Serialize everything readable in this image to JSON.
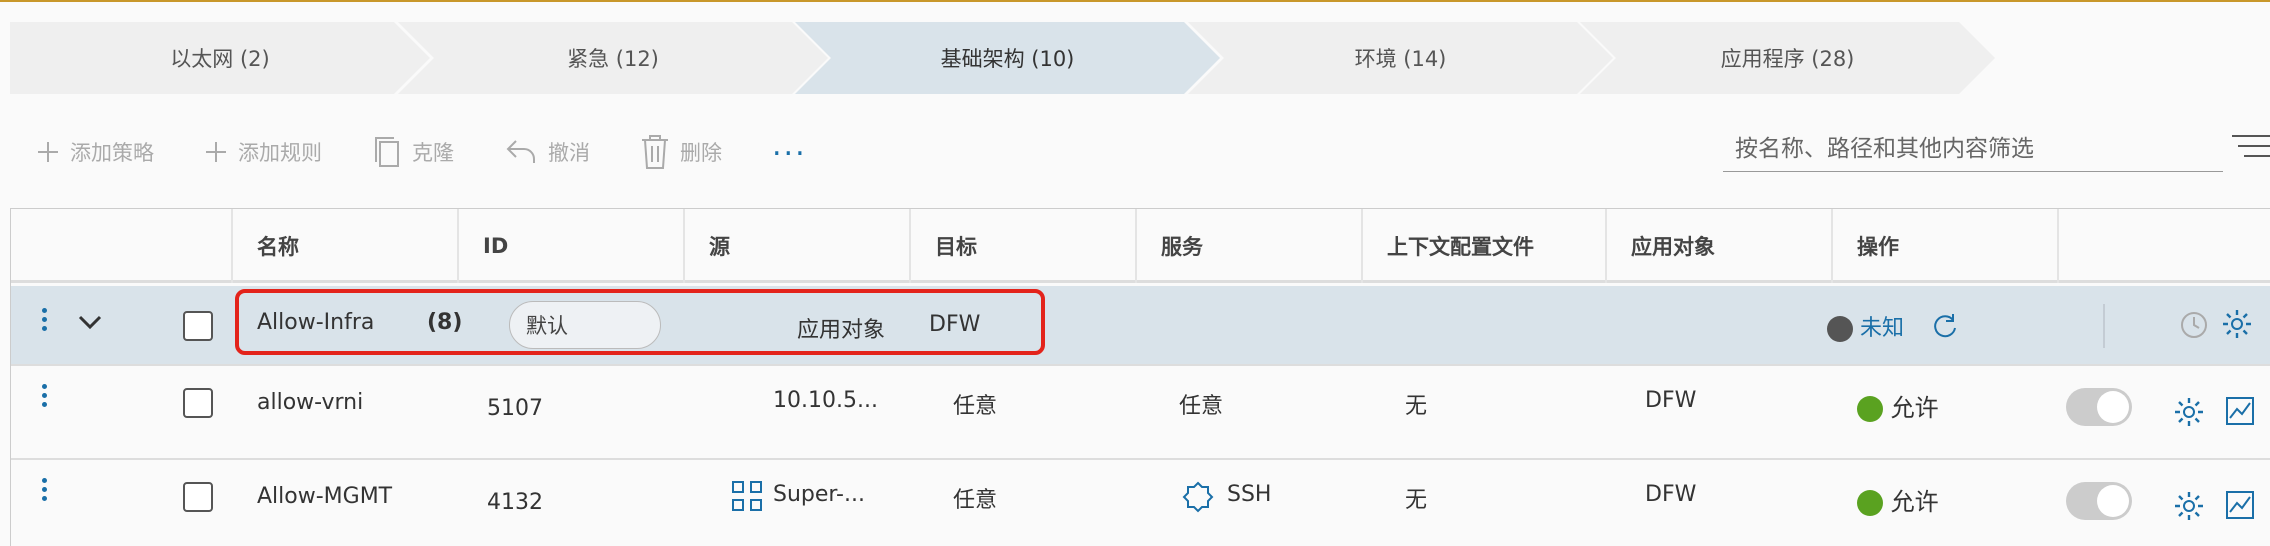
{
  "tabs": [
    {
      "label": "以太网 (2)"
    },
    {
      "label": "紧急 (12)"
    },
    {
      "label": "基础架构 (10)"
    },
    {
      "label": "环境 (14)"
    },
    {
      "label": "应用程序 (28)"
    }
  ],
  "toolbar": {
    "add_policy": "添加策略",
    "add_rule": "添加规则",
    "clone": "克隆",
    "undo": "撤消",
    "delete": "删除",
    "more": "..."
  },
  "search": {
    "placeholder": "按名称、路径和其他内容筛选"
  },
  "columns": [
    "名称",
    "ID",
    "源",
    "目标",
    "服务",
    "上下文配置文件",
    "应用对象",
    "操作"
  ],
  "group": {
    "name": "Allow-Infra",
    "count": "(8)",
    "default_badge": "默认",
    "applied_to_label": "应用对象",
    "applied_to_value": "DFW",
    "status": "未知",
    "status_color": "#555555"
  },
  "rows": [
    {
      "name": "allow-vrni",
      "id": "5107",
      "source": "10.10.5...",
      "destination": "任意",
      "service": "任意",
      "context_profile": "无",
      "applied_to": "DFW",
      "action": "允许",
      "action_color": "#5aa220"
    },
    {
      "name": "Allow-MGMT",
      "id": "4132",
      "source": "Super-...",
      "destination": "任意",
      "service": "SSH",
      "context_profile": "无",
      "applied_to": "DFW",
      "action": "允许",
      "action_color": "#5aa220"
    }
  ],
  "colors": {
    "accent": "#1a6fa8",
    "highlight": "#e3231b",
    "active_tab": "#d9e3ea",
    "top_bar": "#c8972a"
  }
}
